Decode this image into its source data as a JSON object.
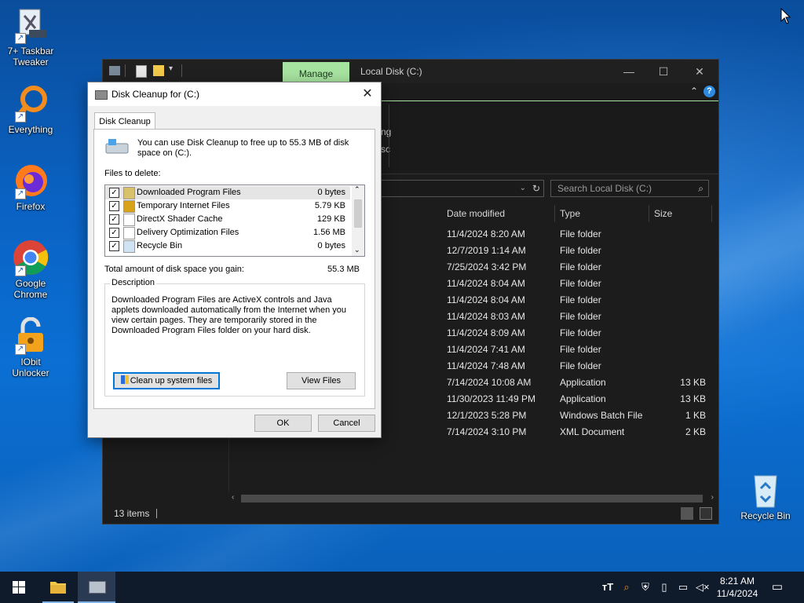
{
  "desktop": {
    "icons": [
      {
        "label": "7+ Taskbar\nTweaker"
      },
      {
        "label": "Everything"
      },
      {
        "label": "Firefox"
      },
      {
        "label": "Google\nChrome"
      },
      {
        "label": "IObit\nUnlocker"
      },
      {
        "label": "Recycle Bin"
      }
    ]
  },
  "explorer": {
    "manage_tab": "Manage",
    "title": "Local Disk (C:)",
    "ribbon_fragment_1": "ng",
    "ribbon_fragment_2": "sc",
    "search_placeholder": "Search Local Disk (C:)",
    "columns": {
      "date": "Date modified",
      "type": "Type",
      "size": "Size"
    },
    "rows": [
      {
        "date": "11/4/2024 8:20 AM",
        "type": "File folder",
        "size": ""
      },
      {
        "date": "12/7/2019 1:14 AM",
        "type": "File folder",
        "size": ""
      },
      {
        "date": "7/25/2024 3:42 PM",
        "type": "File folder",
        "size": ""
      },
      {
        "date": "11/4/2024 8:04 AM",
        "type": "File folder",
        "size": ""
      },
      {
        "date": "11/4/2024 8:04 AM",
        "type": "File folder",
        "size": ""
      },
      {
        "date": "11/4/2024 8:03 AM",
        "type": "File folder",
        "size": ""
      },
      {
        "date": "11/4/2024 8:09 AM",
        "type": "File folder",
        "size": ""
      },
      {
        "date": "11/4/2024 7:41 AM",
        "type": "File folder",
        "size": ""
      },
      {
        "date": "11/4/2024 7:48 AM",
        "type": "File folder",
        "size": ""
      },
      {
        "date": "7/14/2024 10:08 AM",
        "type": "Application",
        "size": "13 KB"
      },
      {
        "date": "11/30/2023 11:49 PM",
        "type": "Application",
        "size": "13 KB"
      },
      {
        "date": "12/1/2023 5:28 PM",
        "type": "Windows Batch File",
        "size": "1 KB"
      },
      {
        "date": "7/14/2024 3:10 PM",
        "type": "XML Document",
        "size": "2 KB"
      }
    ],
    "status_items": "13 items"
  },
  "dialog": {
    "title": "Disk Cleanup for  (C:)",
    "tab": "Disk Cleanup",
    "intro": "You can use Disk Cleanup to free up to 55.3 MB of disk space on  (C:).",
    "files_label": "Files to delete:",
    "files": [
      {
        "name": "Downloaded Program Files",
        "size": "0 bytes",
        "checked": true
      },
      {
        "name": "Temporary Internet Files",
        "size": "5.79 KB",
        "checked": true
      },
      {
        "name": "DirectX Shader Cache",
        "size": "129 KB",
        "checked": true
      },
      {
        "name": "Delivery Optimization Files",
        "size": "1.56 MB",
        "checked": true
      },
      {
        "name": "Recycle Bin",
        "size": "0 bytes",
        "checked": true
      }
    ],
    "total_label": "Total amount of disk space you gain:",
    "total_value": "55.3 MB",
    "description_label": "Description",
    "description_text": "Downloaded Program Files are ActiveX controls and Java applets downloaded automatically from the Internet when you view certain pages. They are temporarily stored in the Downloaded Program Files folder on your hard disk.",
    "cleanup_button": "Clean up system files",
    "view_files_button": "View Files",
    "ok_button": "OK",
    "cancel_button": "Cancel"
  },
  "taskbar": {
    "clock_time": "8:21 AM",
    "clock_date": "11/4/2024"
  }
}
